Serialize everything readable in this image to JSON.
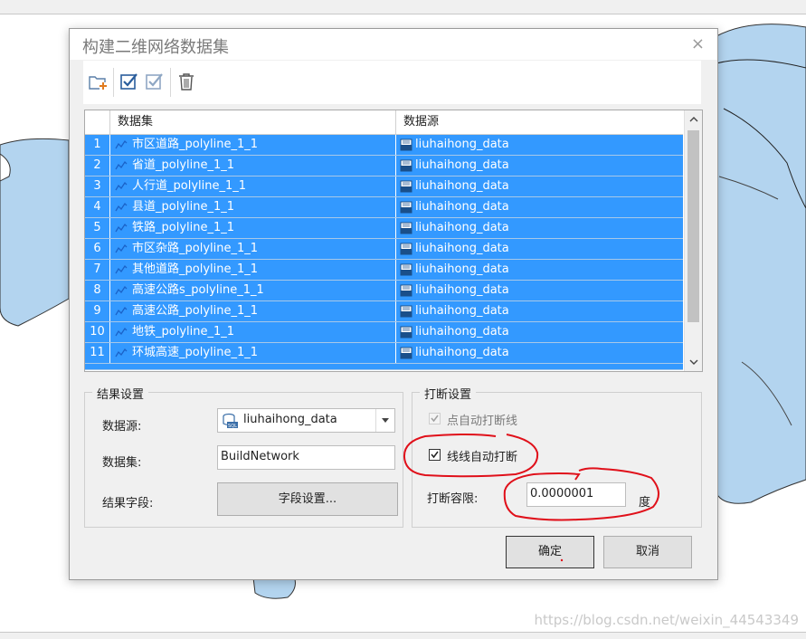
{
  "dialog": {
    "title": "构建二维网络数据集",
    "close_glyph": "×"
  },
  "toolbar": {
    "buttons": [
      "add-dataset-icon",
      "select-all-icon",
      "select-invert-icon",
      "delete-icon"
    ]
  },
  "grid": {
    "columns": [
      "数据集",
      "数据源"
    ],
    "rows": [
      {
        "num": "1",
        "dataset": "市区道路_polyline_1_1",
        "source": "liuhaihong_data"
      },
      {
        "num": "2",
        "dataset": "省道_polyline_1_1",
        "source": "liuhaihong_data"
      },
      {
        "num": "3",
        "dataset": "人行道_polyline_1_1",
        "source": "liuhaihong_data"
      },
      {
        "num": "4",
        "dataset": "县道_polyline_1_1",
        "source": "liuhaihong_data"
      },
      {
        "num": "5",
        "dataset": "铁路_polyline_1_1",
        "source": "liuhaihong_data"
      },
      {
        "num": "6",
        "dataset": "市区杂路_polyline_1_1",
        "source": "liuhaihong_data"
      },
      {
        "num": "7",
        "dataset": "其他道路_polyline_1_1",
        "source": "liuhaihong_data"
      },
      {
        "num": "8",
        "dataset": "高速公路s_polyline_1_1",
        "source": "liuhaihong_data"
      },
      {
        "num": "9",
        "dataset": "高速公路_polyline_1_1",
        "source": "liuhaihong_data"
      },
      {
        "num": "10",
        "dataset": "地铁_polyline_1_1",
        "source": "liuhaihong_data"
      },
      {
        "num": "11",
        "dataset": "环城高速_polyline_1_1",
        "source": "liuhaihong_data"
      }
    ]
  },
  "result_settings": {
    "legend": "结果设置",
    "datasource_label": "数据源:",
    "datasource_value": "liuhaihong_data",
    "dataset_label": "数据集:",
    "dataset_value": "BuildNetwork",
    "field_label": "结果字段:",
    "field_button": "字段设置..."
  },
  "break_settings": {
    "legend": "打断设置",
    "point_auto_break": "点自动打断线",
    "point_auto_break_checked": true,
    "line_auto_break": "线线自动打断",
    "line_auto_break_checked": true,
    "tolerance_label": "打断容限:",
    "tolerance_value": "0.0000001",
    "tolerance_unit": "度"
  },
  "buttons": {
    "ok": "确定",
    "cancel": "取消"
  },
  "watermark": "https://blog.csdn.net/weixin_44543349",
  "colors": {
    "selection": "#3399ff",
    "map_water": "#b3d4ef",
    "annotation": "#e0101a"
  }
}
